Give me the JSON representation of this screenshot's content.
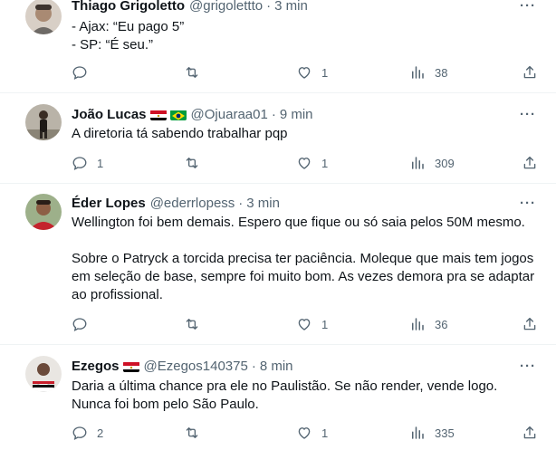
{
  "tweets": [
    {
      "name": "Thiago Grigoletto",
      "handle": "@grigolettto",
      "time": "3 min",
      "text": "- Ajax: “Eu pago 5”\n- SP: “É seu.”",
      "replies": "",
      "retweets": "",
      "likes": "1",
      "views": "38",
      "flags": []
    },
    {
      "name": "João Lucas",
      "handle": "@Ojuaraa01",
      "time": "9 min",
      "text": "A diretoria tá sabendo trabalhar pqp",
      "replies": "1",
      "retweets": "",
      "likes": "1",
      "views": "309",
      "flags": [
        "egypt-flag",
        "brazil-flag"
      ]
    },
    {
      "name": "Éder Lopes",
      "handle": "@ederrlopess",
      "time": "3 min",
      "text": "Wellington foi bem demais. Espero que fique ou só saia pelos 50M mesmo.\n\nSobre o Patryck a torcida precisa ter paciência. Moleque que mais tem jogos em seleção de base, sempre foi muito bom. As vezes demora pra se adaptar ao profissional.",
      "replies": "",
      "retweets": "",
      "likes": "1",
      "views": "36",
      "flags": []
    },
    {
      "name": "Ezegos",
      "handle": "@Ezegos140375",
      "time": "8 min",
      "text": "Daria a última chance pra ele no Paulistão. Se não render, vende logo.\nNunca foi bom pelo São Paulo.",
      "replies": "2",
      "retweets": "",
      "likes": "1",
      "views": "335",
      "flags": [
        "egypt-flag"
      ]
    }
  ],
  "common": {
    "separator": "·",
    "more": "···"
  },
  "colors": {
    "text": "#0f1419",
    "secondary": "#536471",
    "divider": "#eff3f4"
  }
}
